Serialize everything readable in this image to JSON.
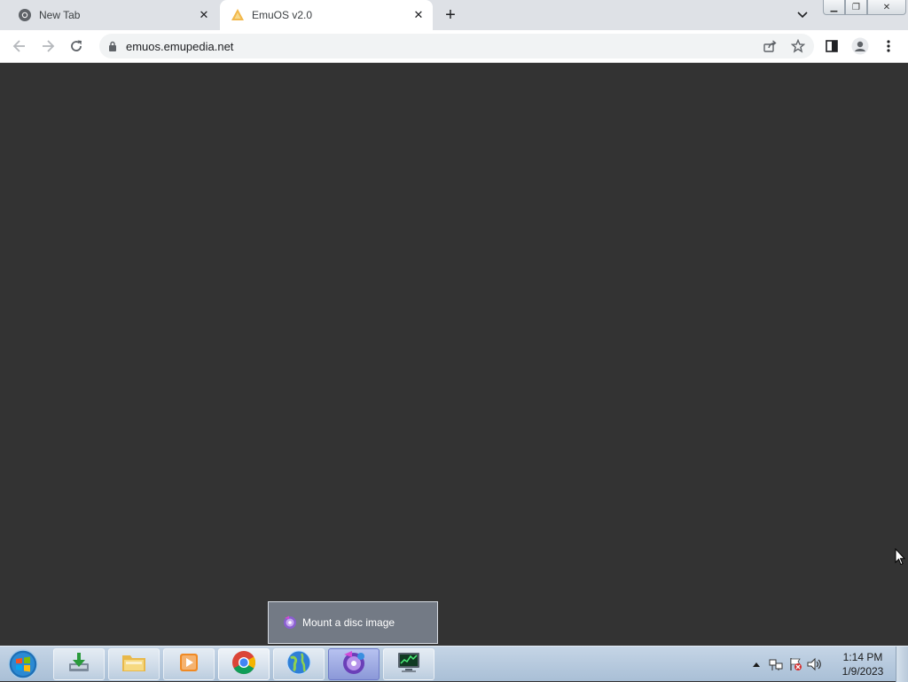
{
  "browser": {
    "tabs": [
      {
        "title": "New Tab",
        "icon": "chrome-icon",
        "active": false
      },
      {
        "title": "EmuOS v2.0",
        "icon": "emuos-icon",
        "active": true
      }
    ],
    "address": "emuos.emupedia.net"
  },
  "page": {
    "background": "#333333"
  },
  "tooltip": {
    "text": "Mount a disc image",
    "icon": "disc-icon"
  },
  "taskbar": {
    "items": [
      {
        "name": "download-app",
        "icon": "download-icon"
      },
      {
        "name": "file-explorer",
        "icon": "folder-icon"
      },
      {
        "name": "media-player",
        "icon": "media-play-icon"
      },
      {
        "name": "chrome",
        "icon": "chrome-icon"
      },
      {
        "name": "internet-browser",
        "icon": "globe-icon"
      },
      {
        "name": "disc-mounter",
        "icon": "disc-icon"
      },
      {
        "name": "system-monitor",
        "icon": "monitor-icon"
      }
    ],
    "clock": {
      "time": "1:14 PM",
      "date": "1/9/2023"
    }
  },
  "colors": {
    "accent": "#1a73e8",
    "tabbar": "#dee1e6",
    "taskbar": "#b8cade"
  }
}
